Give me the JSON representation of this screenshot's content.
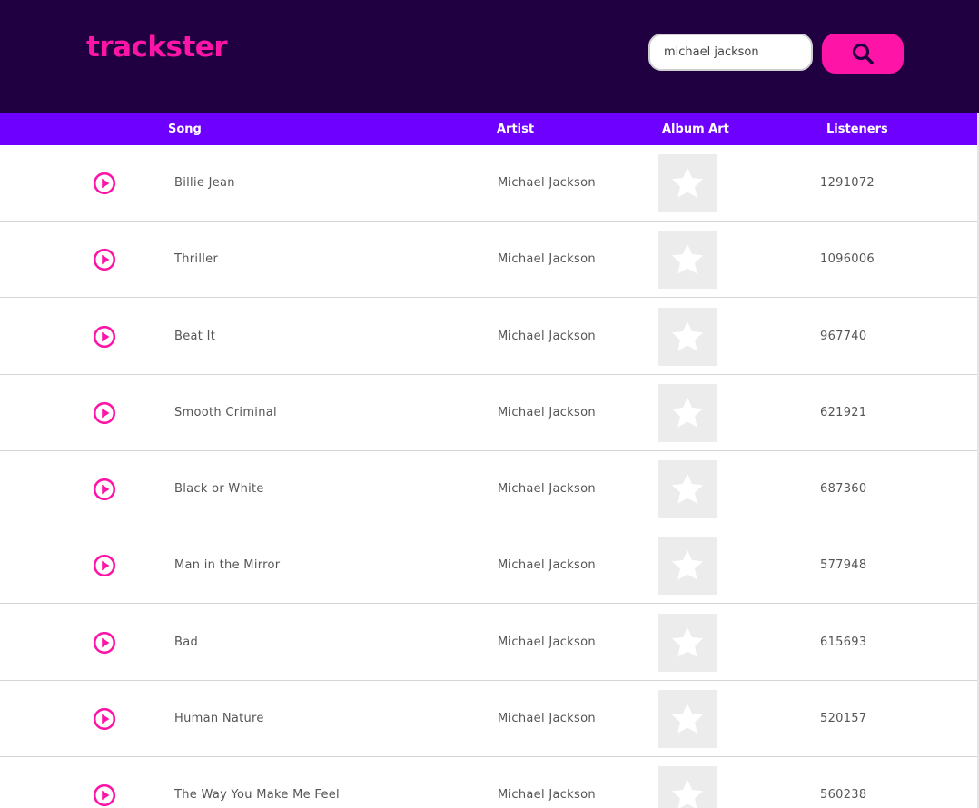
{
  "app": {
    "logo_text": "trackster",
    "brand_color": "#ff14a8",
    "header_bg": "#200040",
    "table_header_bg": "#6e00ff"
  },
  "search": {
    "value": "michael jackson",
    "button_icon": "search-icon"
  },
  "table": {
    "headers": {
      "song": "Song",
      "artist": "Artist",
      "album_art": "Album Art",
      "listeners": "Listeners"
    },
    "rows": [
      {
        "song": "Billie Jean",
        "artist": "Michael Jackson",
        "art_icon": "star-icon",
        "listeners": "1291072"
      },
      {
        "song": "Thriller",
        "artist": "Michael Jackson",
        "art_icon": "star-icon",
        "listeners": "1096006"
      },
      {
        "song": "Beat It",
        "artist": "Michael Jackson",
        "art_icon": "star-icon",
        "listeners": "967740"
      },
      {
        "song": "Smooth Criminal",
        "artist": "Michael Jackson",
        "art_icon": "star-icon",
        "listeners": "621921"
      },
      {
        "song": "Black or White",
        "artist": "Michael Jackson",
        "art_icon": "star-icon",
        "listeners": "687360"
      },
      {
        "song": "Man in the Mirror",
        "artist": "Michael Jackson",
        "art_icon": "star-icon",
        "listeners": "577948"
      },
      {
        "song": "Bad",
        "artist": "Michael Jackson",
        "art_icon": "star-icon",
        "listeners": "615693"
      },
      {
        "song": "Human Nature",
        "artist": "Michael Jackson",
        "art_icon": "star-icon",
        "listeners": "520157"
      },
      {
        "song": "The Way You Make Me Feel",
        "artist": "Michael Jackson",
        "art_icon": "star-icon",
        "listeners": "560238"
      }
    ]
  }
}
